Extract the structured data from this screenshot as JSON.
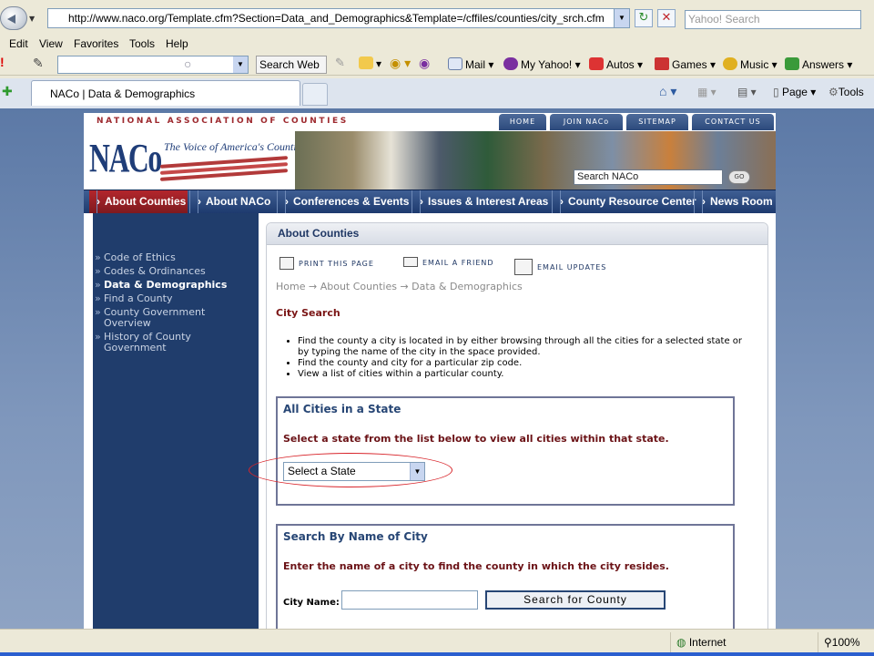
{
  "browser": {
    "url": "http://www.naco.org/Template.cfm?Section=Data_and_Demographics&Template=/cffiles/counties/city_srch.cfm",
    "search_placeholder": "Yahoo! Search",
    "menu": [
      "Edit",
      "View",
      "Favorites",
      "Tools",
      "Help"
    ],
    "toolbar": {
      "search_web": "Search Web",
      "mail": "Mail",
      "my_yahoo": "My Yahoo!",
      "autos": "Autos",
      "games": "Games",
      "music": "Music",
      "answers": "Answers"
    },
    "tab_title": "NACo | Data & Demographics",
    "commands": {
      "page": "Page",
      "tools": "Tools"
    }
  },
  "site": {
    "org_name": "NATIONAL ASSOCIATION OF COUNTIES",
    "topnav": [
      "HOME",
      "JOIN NACo",
      "SITEMAP",
      "CONTACT US"
    ],
    "logo_text": "NACo",
    "tagline": "The Voice of America's Counties",
    "search_value": "Search NACo",
    "go_label": "GO",
    "mainnav": [
      "About Counties",
      "About NACo",
      "Conferences & Events",
      "Issues & Interest Areas",
      "County Resource Center",
      "News Room"
    ]
  },
  "sidebar": {
    "items": [
      "Code of Ethics",
      "Codes & Ordinances",
      "Data & Demographics",
      "Find a County",
      "County Government Overview",
      "History of County Government"
    ]
  },
  "content": {
    "title": "About Counties",
    "utilities": {
      "print": "PRINT THIS PAGE",
      "email": "EMAIL A FRIEND",
      "updates": "EMAIL UPDATES"
    },
    "breadcrumb": {
      "home": "Home",
      "about": "About Counties",
      "current": "Data & Demographics",
      "sep": "→"
    },
    "heading": "City Search",
    "bullets": [
      "Find the county a city is located in by either browsing through all the cities for a selected state or by typing the name of the city in the space provided.",
      "Find the county and city for a particular zip code.",
      "View a list of cities within a particular county."
    ],
    "state_box": {
      "title": "All Cities in a State",
      "description": "Select a state from the list below to view all cities within that state.",
      "select_value": "Select a State"
    },
    "city_box": {
      "title": "Search By Name of City",
      "description": "Enter the name of a city to find the county in which the city resides.",
      "label": "City Name:",
      "button": "Search for County"
    }
  },
  "status": {
    "zone": "Internet",
    "zoom": "100%"
  },
  "colors": {
    "accent_red": "#9e2a2f",
    "nav_blue": "#1e3a6e",
    "sidebar": "#203d6c",
    "highlight": "#d8242a"
  }
}
